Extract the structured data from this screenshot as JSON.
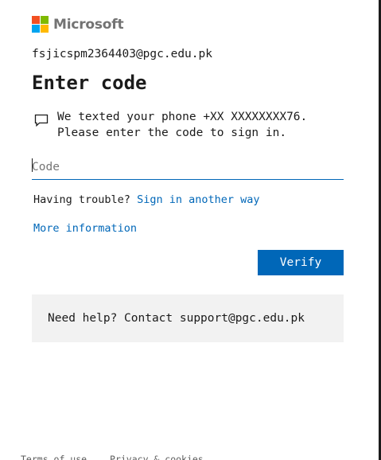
{
  "brand": {
    "name": "Microsoft",
    "colors": [
      "#f25022",
      "#7fba00",
      "#00a4ef",
      "#ffb900"
    ]
  },
  "account": {
    "email": "fsjicspm2364403@pgc.edu.pk"
  },
  "heading": "Enter code",
  "message": {
    "icon": "chat-bubble-icon",
    "line1": "We texted your phone +XX XXXXXXXX76.",
    "line2": "Please enter the code to sign in."
  },
  "code_field": {
    "placeholder": "Code",
    "value": ""
  },
  "trouble": {
    "prefix": "Having trouble?",
    "link": "Sign in another way"
  },
  "more_info": "More information",
  "verify_button": "Verify",
  "help": {
    "text": "Need help? Contact support@pgc.edu.pk"
  },
  "footer": {
    "terms": "Terms of use",
    "privacy": "Privacy & cookies"
  },
  "colors": {
    "accent": "#0067b8",
    "help_background": "#f2f2f2",
    "text": "#1b1b1b"
  }
}
